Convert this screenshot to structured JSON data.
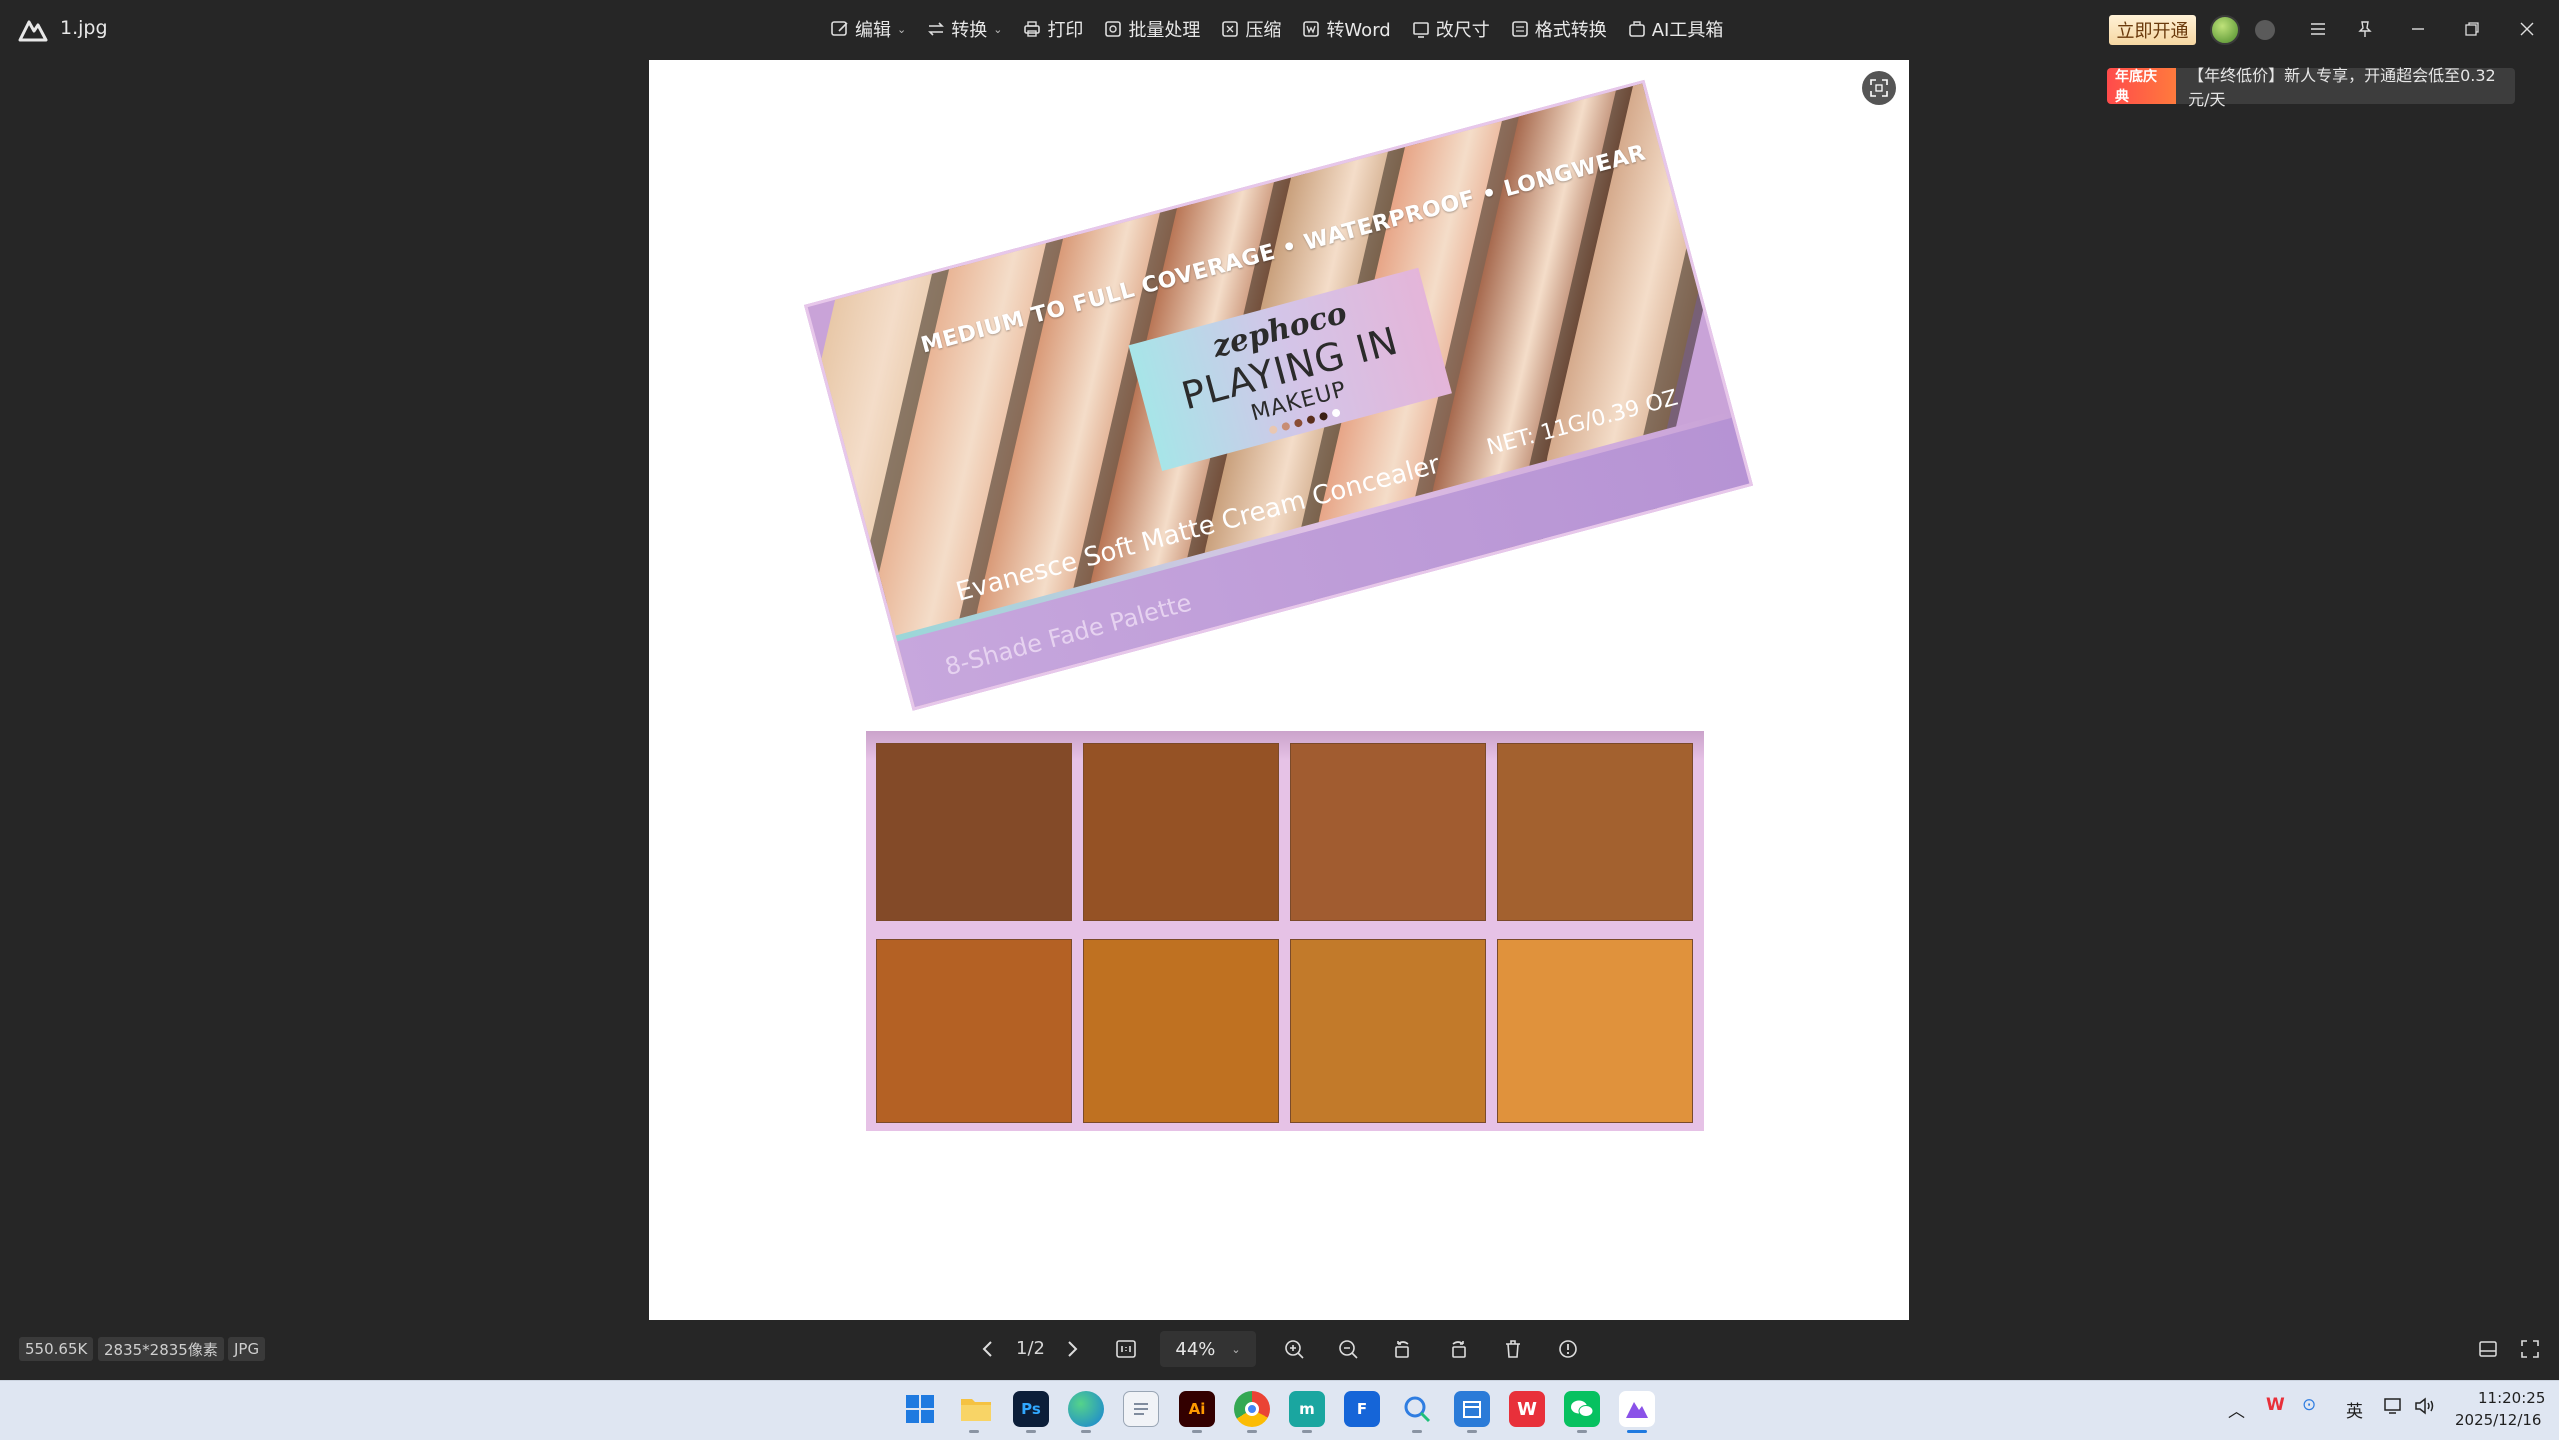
{
  "window": {
    "file_name": "1.jpg"
  },
  "toolbar": {
    "items": [
      {
        "label": "编辑",
        "icon": "edit-icon",
        "dropdown": true
      },
      {
        "label": "转换",
        "icon": "convert-icon",
        "dropdown": true
      },
      {
        "label": "打印",
        "icon": "print-icon",
        "dropdown": false
      },
      {
        "label": "批量处理",
        "icon": "batch-icon",
        "dropdown": false
      },
      {
        "label": "压缩",
        "icon": "compress-icon",
        "dropdown": false
      },
      {
        "label": "转Word",
        "icon": "word-icon",
        "dropdown": false
      },
      {
        "label": "改尺寸",
        "icon": "resize-icon",
        "dropdown": false
      },
      {
        "label": "格式转换",
        "icon": "format-icon",
        "dropdown": false
      },
      {
        "label": "AI工具箱",
        "icon": "ai-toolbox-icon",
        "dropdown": false
      }
    ]
  },
  "header": {
    "vip_label": "立即开通"
  },
  "promo": {
    "tag": "年底庆典",
    "text": "【年终低价】新人专享，开通超会低至0.32元/天"
  },
  "image": {
    "tagline": "MEDIUM TO FULL COVERAGE • WATERPROOF • LONGWEAR",
    "brand": "zephoco",
    "title_line1": "PLAYING IN",
    "title_line2": "MAKEUP",
    "product_name": "Evanesce Soft Matte Cream Concealer",
    "net_weight": "NET:  11G/0.39 OZ",
    "palette_name": "8-Shade Fade Palette",
    "stripe_colors": [
      "#e8c8a8",
      "#e9b596",
      "#d99a78",
      "#b97656",
      "#c9a07c",
      "#e7a587",
      "#a76a4f",
      "#d5aa8c"
    ],
    "brand_dot_colors": [
      "#e9c7b2",
      "#c88d74",
      "#8a4d35",
      "#5a2e1c",
      "#3b1f14",
      "#ffffff"
    ],
    "shade_colors": [
      "#834a28",
      "#955225",
      "#a15c30",
      "#a3612f",
      "#b46124",
      "#bf7121",
      "#c27a2a",
      "#e0923c"
    ]
  },
  "status": {
    "file_size": "550.65K",
    "dimensions": "2835*2835像素",
    "format": "JPG",
    "page": "1/2",
    "zoom": "44%"
  },
  "taskbar": {
    "apps": [
      "start",
      "file-explorer",
      "photoshop",
      "edge",
      "notepad",
      "illustrator",
      "chrome",
      "app-m",
      "app-f",
      "app-search",
      "app-calendar",
      "wps",
      "wechat",
      "image-viewer"
    ],
    "ime": "英",
    "time": "11:20:25",
    "date": "2025/12/16"
  }
}
